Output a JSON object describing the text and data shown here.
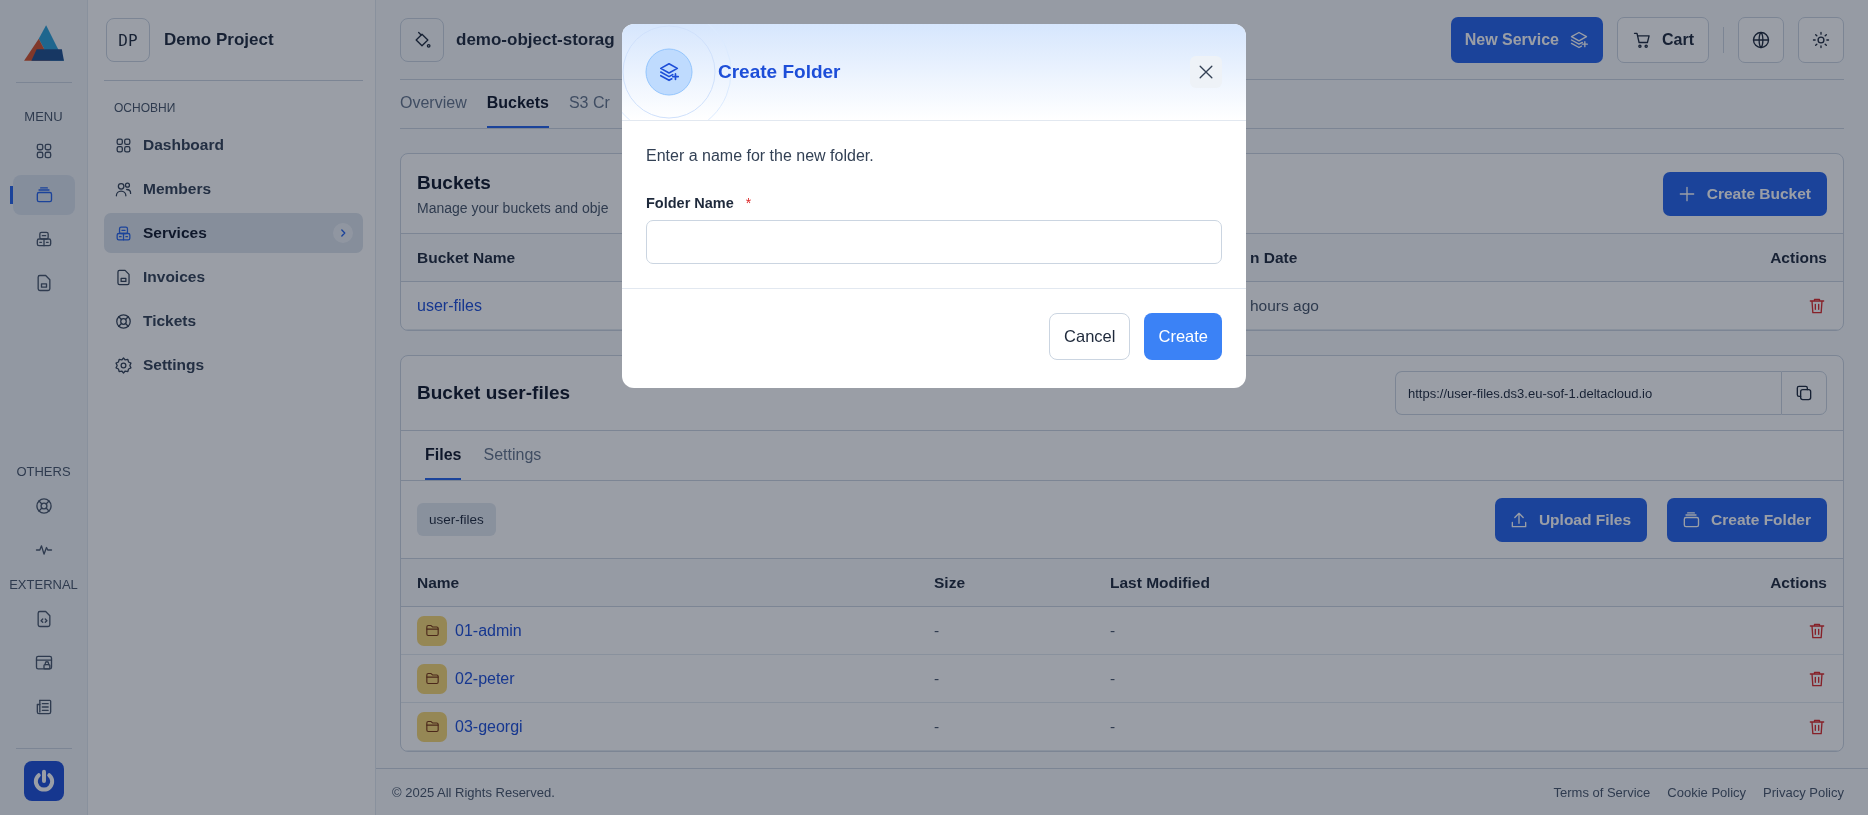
{
  "rail": {
    "groups": [
      {
        "label": "MENU",
        "items": [
          {
            "selected": false
          },
          {
            "selected": true
          },
          {
            "selected": false
          },
          {
            "selected": false
          }
        ]
      },
      {
        "label": "OTHERS",
        "items": [
          {
            "selected": false
          },
          {
            "selected": false
          }
        ]
      },
      {
        "label": "EXTERNAL",
        "items": [
          {
            "selected": false
          },
          {
            "selected": false
          },
          {
            "selected": false
          }
        ]
      }
    ]
  },
  "sidebar": {
    "project": {
      "initials": "DP",
      "name": "Demo Project"
    },
    "section": "ОСНОВНИ",
    "items": [
      {
        "label": "Dashboard",
        "selected": false
      },
      {
        "label": "Members",
        "selected": false
      },
      {
        "label": "Services",
        "selected": true
      },
      {
        "label": "Invoices",
        "selected": false
      },
      {
        "label": "Tickets",
        "selected": false
      },
      {
        "label": "Settings",
        "selected": false
      }
    ]
  },
  "header": {
    "title": "demo-object-storag",
    "new_service": "New Service",
    "cart": "Cart"
  },
  "tabs": [
    {
      "label": "Overview",
      "selected": false
    },
    {
      "label": "Buckets",
      "selected": true
    },
    {
      "label": "S3 Cr",
      "selected": false
    }
  ],
  "buckets": {
    "title": "Buckets",
    "description": "Manage your buckets and obje",
    "create_button": "Create Bucket",
    "columns": [
      "Bucket Name",
      "n Date",
      "Actions"
    ],
    "rows": [
      {
        "name": "user-files",
        "date": "hours ago"
      }
    ]
  },
  "bucket": {
    "title": "Bucket user-files",
    "url": "https://user-files.ds3.eu-sof-1.deltacloud.io",
    "tabs": [
      {
        "label": "Files",
        "selected": true
      },
      {
        "label": "Settings",
        "selected": false
      }
    ],
    "breadcrumb": [
      "user-files"
    ],
    "upload_button": "Upload Files",
    "create_folder_button": "Create Folder",
    "columns": [
      "Name",
      "Size",
      "Last Modified",
      "Actions"
    ],
    "rows": [
      {
        "name": "01-admin",
        "size": "-",
        "modified": "-"
      },
      {
        "name": "02-peter",
        "size": "-",
        "modified": "-"
      },
      {
        "name": "03-georgi",
        "size": "-",
        "modified": "-"
      }
    ]
  },
  "footer": {
    "copyright": "© 2025 All Rights Reserved.",
    "links": [
      "Terms of Service",
      "Cookie Policy",
      "Privacy Policy"
    ]
  },
  "dialog": {
    "title": "Create Folder",
    "description": "Enter a name for the new folder.",
    "field": {
      "label": "Folder Name",
      "required_mark": "*"
    },
    "buttons": [
      {
        "label": "Cancel",
        "kind": "secondary"
      },
      {
        "label": "Create",
        "kind": "primary"
      }
    ]
  }
}
